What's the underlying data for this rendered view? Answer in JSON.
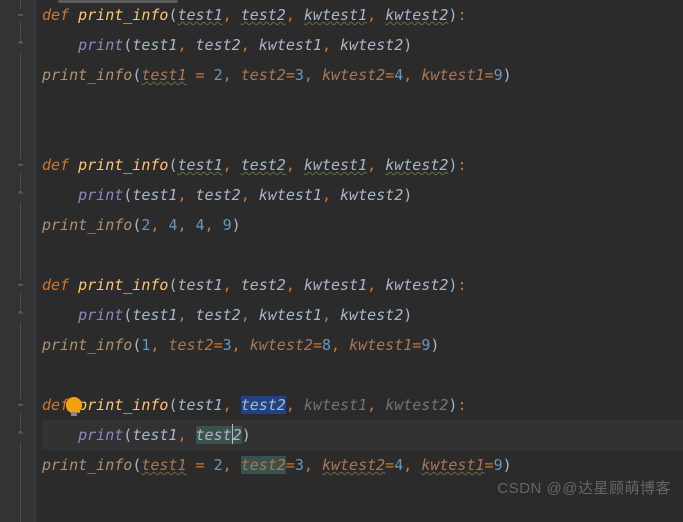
{
  "colors": {
    "bg": "#2b2b2b",
    "gutter": "#313335",
    "keyword": "#cc7832",
    "function": "#ffc66d",
    "number": "#6897bb",
    "builtin": "#8888c6",
    "selection": "#214283"
  },
  "watermark": "CSDN @@达星顾萌博客",
  "tokens": {
    "def": "def",
    "print_info": "print_info",
    "print": "print",
    "lp": "(",
    "rp": ")",
    "colon": ":",
    "comma": ",",
    "eq": "=",
    "sp": " ",
    "test1": "test1",
    "test2": "test2",
    "kwtest1": "kwtest1",
    "kwtest2": "kwtest2",
    "test": "test",
    "n1": "1",
    "n2": "2",
    "n3": "3",
    "n4": "4",
    "n8": "8",
    "n9": "9",
    "ind1": "    ",
    "ind2": "        "
  }
}
